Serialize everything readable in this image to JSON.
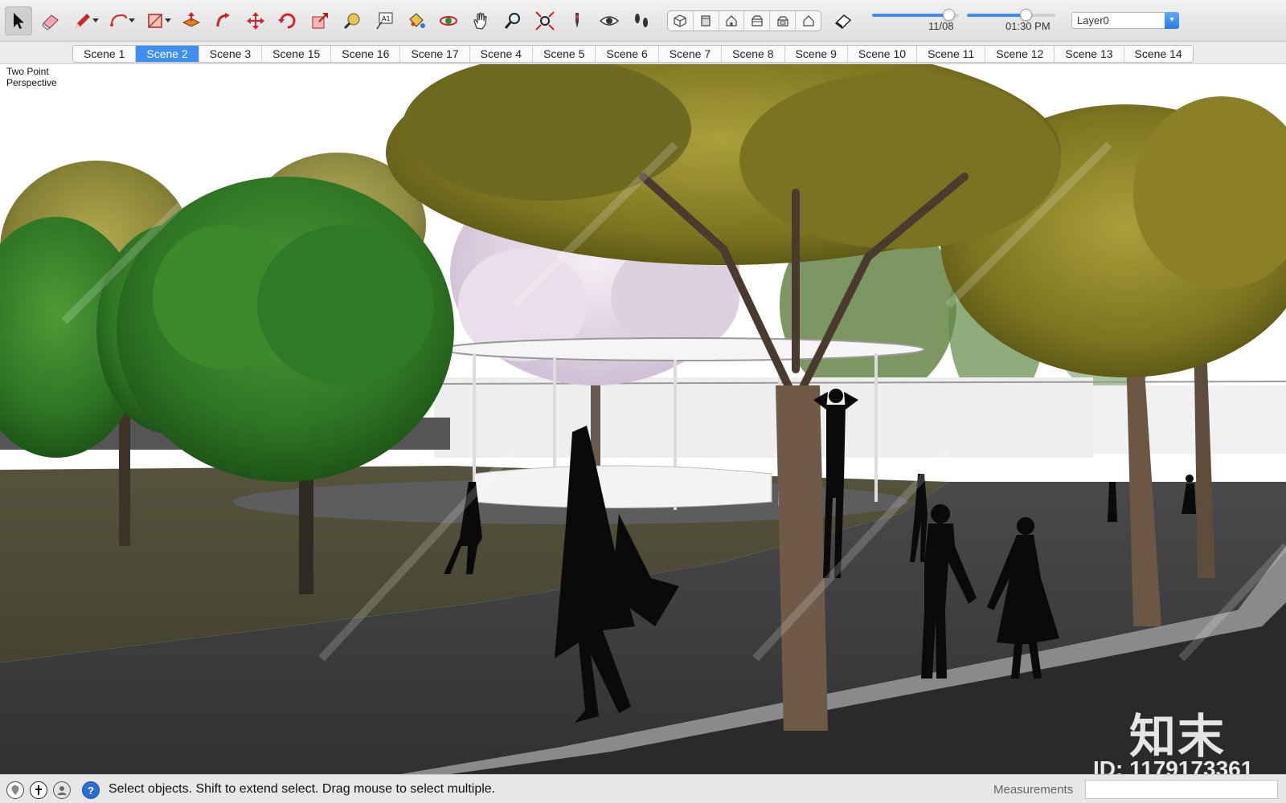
{
  "toolbar": {
    "tools": [
      {
        "name": "select-tool",
        "icon": "arrow-cursor-icon",
        "active": true
      },
      {
        "name": "eraser-tool",
        "icon": "eraser-icon"
      },
      {
        "name": "line-tool",
        "icon": "pencil-icon",
        "dropdown": true
      },
      {
        "name": "arc-tool",
        "icon": "arc-icon",
        "dropdown": true
      },
      {
        "name": "rectangle-tool",
        "icon": "rectangle-icon",
        "dropdown": true
      },
      {
        "name": "push-pull-tool",
        "icon": "push-pull-icon"
      },
      {
        "name": "follow-me-tool",
        "icon": "follow-me-icon"
      },
      {
        "name": "move-tool",
        "icon": "move-icon"
      },
      {
        "name": "rotate-tool",
        "icon": "rotate-icon"
      },
      {
        "name": "scale-tool",
        "icon": "scale-icon"
      },
      {
        "name": "tape-measure-tool",
        "icon": "tape-measure-icon"
      },
      {
        "name": "text-tool",
        "icon": "text-icon"
      },
      {
        "name": "paint-bucket-tool",
        "icon": "paint-bucket-icon"
      },
      {
        "name": "orbit-tool",
        "icon": "orbit-icon"
      },
      {
        "name": "pan-tool",
        "icon": "hand-icon"
      },
      {
        "name": "zoom-tool",
        "icon": "magnifier-icon"
      },
      {
        "name": "zoom-extents-tool",
        "icon": "zoom-extents-icon"
      },
      {
        "name": "position-camera-tool",
        "icon": "position-camera-icon"
      },
      {
        "name": "look-around-tool",
        "icon": "eye-icon"
      },
      {
        "name": "walk-tool",
        "icon": "footprints-icon"
      }
    ],
    "views": [
      "iso-view-icon",
      "top-view-icon",
      "front-view-icon",
      "right-view-icon",
      "back-view-icon",
      "left-view-icon"
    ],
    "section_plane_icon": "section-plane-icon",
    "date_label": "11/08",
    "time_label": "01:30 PM",
    "date_value": 0.88,
    "time_value": 0.66,
    "layer_value": "Layer0"
  },
  "scenes": {
    "tabs": [
      "Scene 1",
      "Scene 2",
      "Scene 3",
      "Scene 15",
      "Scene 16",
      "Scene 17",
      "Scene 4",
      "Scene 5",
      "Scene 6",
      "Scene 7",
      "Scene 8",
      "Scene 9",
      "Scene 10",
      "Scene 11",
      "Scene 12",
      "Scene 13",
      "Scene 14"
    ],
    "active_index": 1
  },
  "viewport": {
    "camera_label_line1": "Two Point",
    "camera_label_line2": "Perspective",
    "watermark_brand": "知末",
    "watermark_id": "ID: 1179173361"
  },
  "statusbar": {
    "icons": [
      "geo-location-icon",
      "credits-icon",
      "user-account-icon",
      "help-icon"
    ],
    "message": "Select objects. Shift to extend select. Drag mouse to select multiple.",
    "measurements_label": "Measurements",
    "measurements_value": ""
  },
  "colors": {
    "accent": "#3d8ff3",
    "road": "#3b3b3c",
    "lawn": "#4d4c37",
    "tree_green": "#2f7a26",
    "tree_olive": "#7d7a1f",
    "blossom": "#e7dbe9",
    "silhouette": "#0a0a0a"
  }
}
